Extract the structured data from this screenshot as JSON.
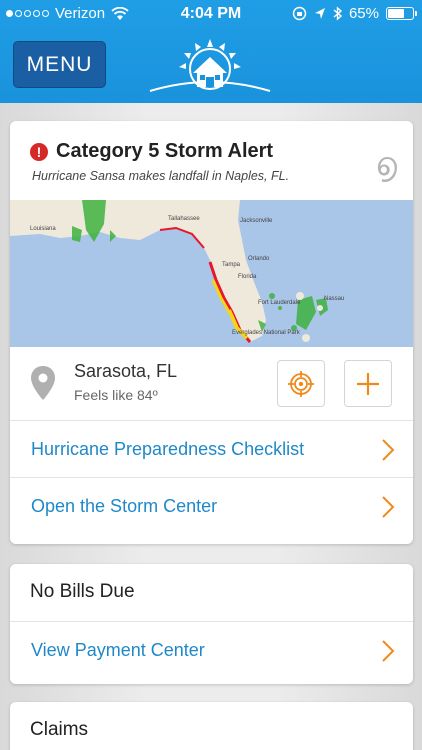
{
  "status_bar": {
    "carrier": "Verizon",
    "time": "4:04 PM",
    "battery": "65%",
    "battery_level": 0.65
  },
  "nav": {
    "menu_label": "MENU"
  },
  "alert": {
    "title": "Category 5 Storm Alert",
    "subtitle": "Hurricane Sansa makes landfall in Naples, FL.",
    "storm_symbol": "൭"
  },
  "map": {
    "labels": [
      "Louisiana",
      "Tallahassee",
      "Jacksonville",
      "Orlando",
      "Tampa",
      "Florida",
      "Fort Lauderdale",
      "Nassau",
      "Everglades National Park"
    ]
  },
  "location": {
    "city": "Sarasota, FL",
    "feels_like": "Feels like 84º"
  },
  "links": {
    "checklist": "Hurricane Preparedness Checklist",
    "storm_center": "Open the Storm Center",
    "payment_center": "View Payment Center"
  },
  "bills": {
    "title": "No Bills Due"
  },
  "claims": {
    "title": "Claims"
  },
  "colors": {
    "header_blue": "#1f9ee6",
    "menu_blue": "#1a5fa3",
    "link_blue": "#1f88c9",
    "accent_orange": "#f08a1c",
    "alert_red": "#d72828"
  }
}
